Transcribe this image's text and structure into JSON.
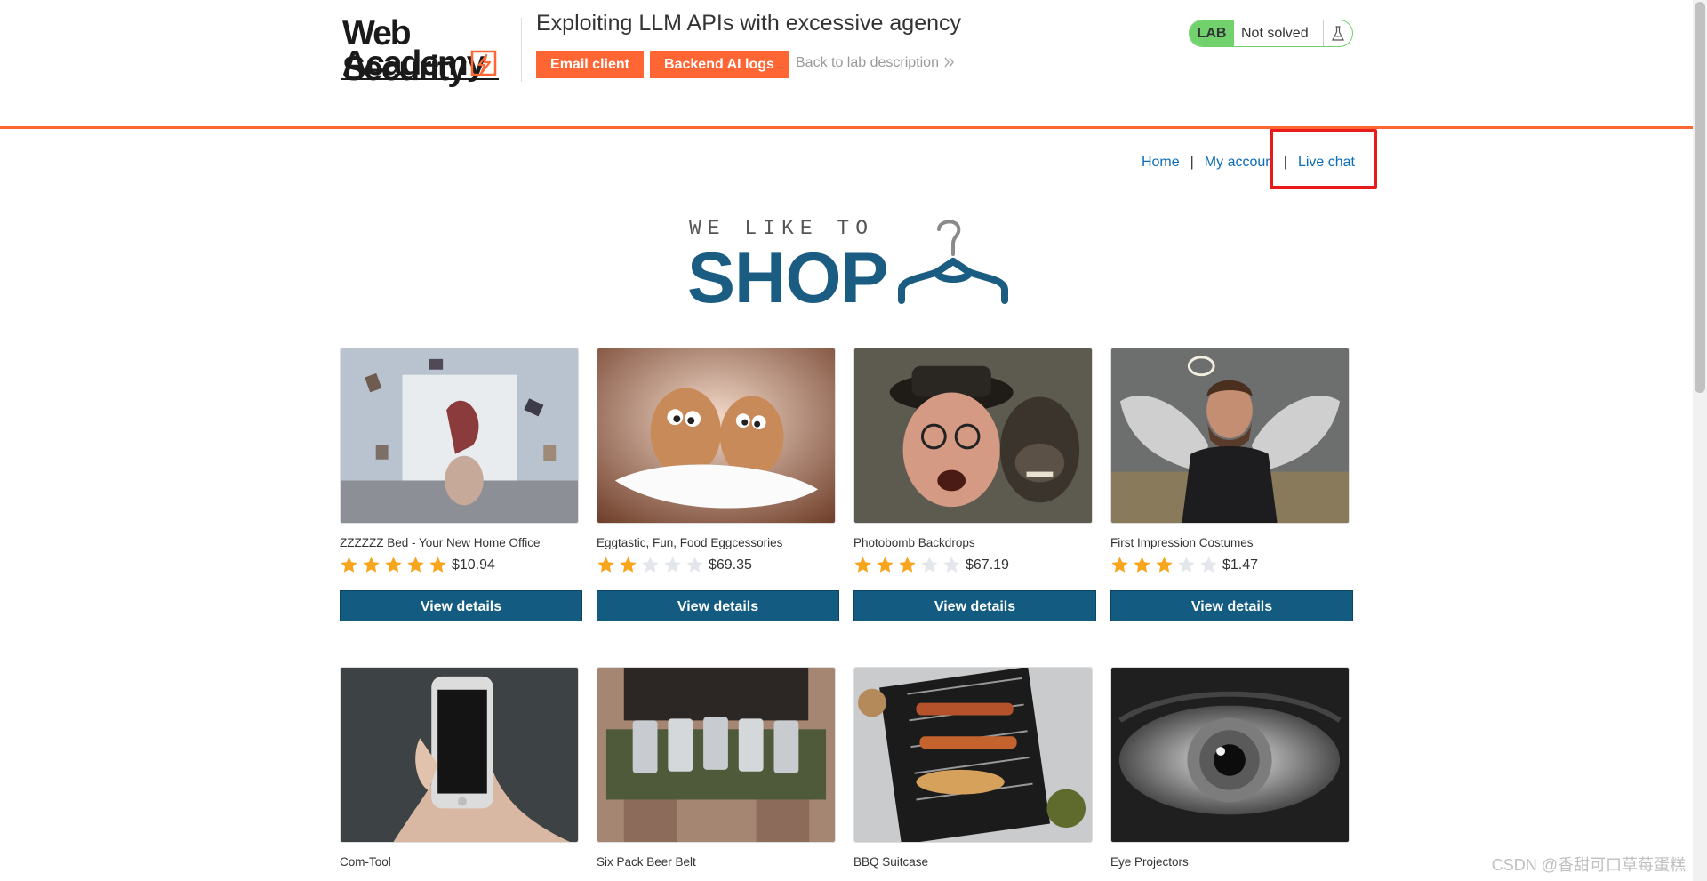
{
  "academy": {
    "logo_line1": "Web Security",
    "logo_line2": "Academy",
    "lab_title": "Exploiting LLM APIs with excessive agency",
    "email_client_label": "Email client",
    "backend_logs_label": "Backend AI logs",
    "back_link_label": "Back to lab description",
    "lab_badge": "LAB",
    "lab_status": "Not solved",
    "icons": {
      "flask": "flask-icon",
      "chevron": "double-chevron-right-icon"
    }
  },
  "nav": {
    "home": "Home",
    "separator": "|",
    "my_account": "My account",
    "live_chat": "Live chat"
  },
  "banner": {
    "subtitle": "WE LIKE TO",
    "title": "SHOP"
  },
  "products": [
    {
      "name": "ZZZZZZ Bed - Your New Home Office",
      "stars": 5,
      "price": "$10.94",
      "button": "View details"
    },
    {
      "name": "Eggtastic, Fun, Food Eggcessories",
      "stars": 2,
      "price": "$69.35",
      "button": "View details"
    },
    {
      "name": "Photobomb Backdrops",
      "stars": 3,
      "price": "$67.19",
      "button": "View details"
    },
    {
      "name": "First Impression Costumes",
      "stars": 3,
      "price": "$1.47",
      "button": "View details"
    },
    {
      "name": "Com-Tool",
      "stars": 0,
      "price": "",
      "button": ""
    },
    {
      "name": "Six Pack Beer Belt",
      "stars": 0,
      "price": "",
      "button": ""
    },
    {
      "name": "BBQ Suitcase",
      "stars": 0,
      "price": "",
      "button": ""
    },
    {
      "name": "Eye Projectors",
      "stars": 0,
      "price": "",
      "button": ""
    }
  ],
  "colors": {
    "accent_orange": "#ff6633",
    "lab_green": "#70d16d",
    "link_blue": "#0a6bb6",
    "button_blue": "#135b80",
    "star_gold": "#f7a51c",
    "highlight_red": "#e81a1a"
  },
  "watermark": "CSDN @香甜可口草莓蛋糕"
}
